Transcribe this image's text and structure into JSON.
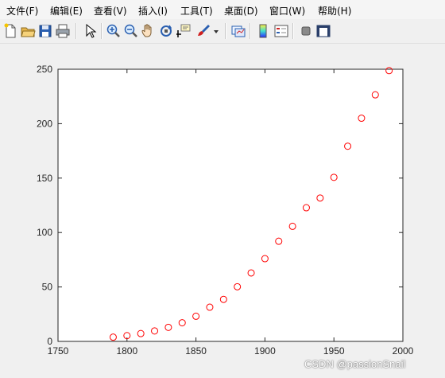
{
  "menu": [
    "文件(F)",
    "编辑(E)",
    "查看(V)",
    "插入(I)",
    "工具(T)",
    "桌面(D)",
    "窗口(W)",
    "帮助(H)"
  ],
  "toolbar": {
    "icons": [
      "new-file-icon",
      "open-folder-icon",
      "save-icon",
      "print-icon",
      "pointer-icon",
      "zoom-in-icon",
      "zoom-out-icon",
      "pan-hand-icon",
      "rotate-3d-icon",
      "data-cursor-icon",
      "brush-icon",
      "dropdown-arrow-icon",
      "link-plot-icon",
      "colorbar-icon",
      "legend-icon",
      "hide-plot-tools-icon",
      "show-plot-tools-icon"
    ]
  },
  "chart_data": {
    "type": "scatter",
    "marker": "circle",
    "marker_color": "#ff0000",
    "x": [
      1790,
      1800,
      1810,
      1820,
      1830,
      1840,
      1850,
      1860,
      1870,
      1880,
      1890,
      1900,
      1910,
      1920,
      1930,
      1940,
      1950,
      1960,
      1970,
      1980,
      1990
    ],
    "y": [
      3.9,
      5.3,
      7.2,
      9.6,
      12.9,
      17.1,
      23.1,
      31.4,
      38.6,
      50.2,
      62.9,
      76.0,
      92.0,
      105.7,
      122.8,
      131.7,
      150.7,
      179.3,
      205.0,
      226.5,
      248.7
    ],
    "xlim": [
      1750,
      2000
    ],
    "ylim": [
      0,
      250
    ],
    "xticks": [
      1750,
      1800,
      1850,
      1900,
      1950,
      2000
    ],
    "yticks": [
      0,
      50,
      100,
      150,
      200,
      250
    ],
    "grid": false,
    "title": "",
    "xlabel": "",
    "ylabel": ""
  },
  "watermark": "CSDN @passionSnail"
}
